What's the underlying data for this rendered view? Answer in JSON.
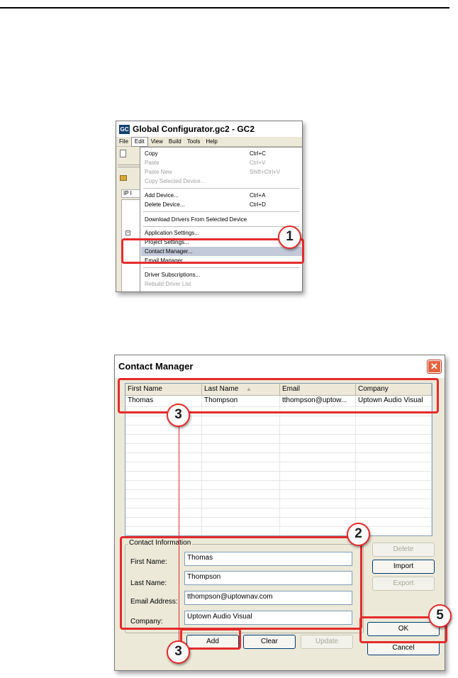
{
  "window1": {
    "title": "Global Configurator.gc2 - GC2",
    "app_icon": "GC",
    "menubar": [
      "File",
      "Edit",
      "View",
      "Build",
      "Tools",
      "Help"
    ],
    "ip_tab": "IP I",
    "tree_expand": "−",
    "edit_menu": {
      "items": [
        {
          "label": "Copy",
          "shortcut": "Ctrl+C",
          "disabled": false
        },
        {
          "label": "Paste",
          "shortcut": "Ctrl+V",
          "disabled": true
        },
        {
          "label": "Paste New",
          "shortcut": "Shift+Ctrl+V",
          "disabled": true
        },
        {
          "label": "Copy Selected Device...",
          "shortcut": "",
          "disabled": true
        },
        {
          "label": "Add Device...",
          "shortcut": "Ctrl+A",
          "disabled": false
        },
        {
          "label": "Delete Device...",
          "shortcut": "Ctrl+D",
          "disabled": false
        },
        {
          "label": "Download Drivers From Selected Device",
          "shortcut": "",
          "disabled": false
        },
        {
          "label": "Application Settings...",
          "shortcut": "",
          "disabled": false
        },
        {
          "label": "Project Settings...",
          "shortcut": "",
          "disabled": false
        },
        {
          "label": "Contact Manager...",
          "shortcut": "",
          "disabled": false,
          "selected": true
        },
        {
          "label": "Email Manager...",
          "shortcut": "",
          "disabled": false
        },
        {
          "label": "Driver Subscriptions...",
          "shortcut": "",
          "disabled": false
        },
        {
          "label": "Rebuild Driver List",
          "shortcut": "",
          "disabled": true
        }
      ]
    }
  },
  "callouts": {
    "c1": "1",
    "c2": "2",
    "c3": "3",
    "c5": "5"
  },
  "dialog": {
    "title": "Contact Manager",
    "close_glyph": "✕",
    "columns": [
      "First Name",
      "Last Name",
      "Email",
      "Company"
    ],
    "sort_indicator": "▲",
    "rows": [
      [
        "Thomas",
        "Thompson",
        "tthompson@uptow...",
        "Uptown Audio Visual"
      ]
    ],
    "contact_info": {
      "legend": "Contact Information",
      "first_name_label": "First Name:",
      "last_name_label": "Last Name:",
      "email_label": "Email Address:",
      "company_label": "Company:",
      "first_name": "Thomas",
      "last_name": "Thompson",
      "email": "tthompson@uptownav.com",
      "company": "Uptown Audio Visual"
    },
    "buttons": {
      "add": "Add",
      "clear": "Clear",
      "update": "Update",
      "delete": "Delete",
      "import": "Import",
      "export": "Export",
      "ok": "OK",
      "cancel": "Cancel"
    }
  },
  "colors": {
    "callout_red": "#e42b2b",
    "menu_highlight": "#c2c9d9"
  }
}
